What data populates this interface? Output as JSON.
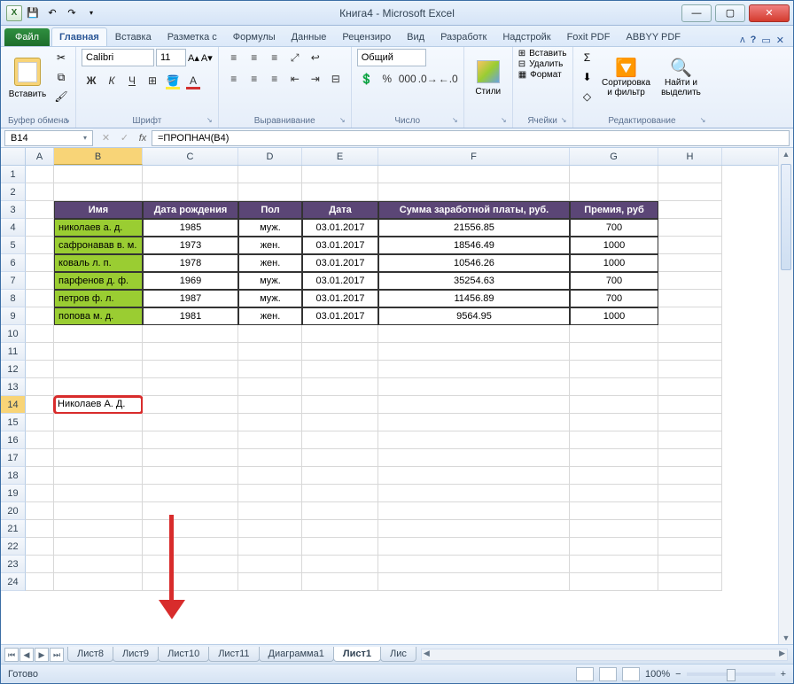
{
  "title": "Книга4 - Microsoft Excel",
  "tabs": {
    "file": "Файл",
    "home": "Главная",
    "insert": "Вставка",
    "layout": "Разметка с",
    "formulas": "Формулы",
    "data": "Данные",
    "review": "Рецензиро",
    "view": "Вид",
    "developer": "Разработк",
    "addins": "Надстройк",
    "foxit": "Foxit PDF",
    "abbyy": "ABBYY PDF"
  },
  "ribbon": {
    "paste": "Вставить",
    "clipboard": "Буфер обмена",
    "font_name": "Calibri",
    "font_size": "11",
    "font_group": "Шрифт",
    "align_group": "Выравнивание",
    "number_format": "Общий",
    "number_group": "Число",
    "styles": "Стили",
    "insert_cells": "Вставить",
    "delete_cells": "Удалить",
    "format_cells": "Формат",
    "cells_group": "Ячейки",
    "sort": "Сортировка\nи фильтр",
    "find": "Найти и\nвыделить",
    "editing_group": "Редактирование"
  },
  "name_box": "B14",
  "formula": "=ПРОПНАЧ(B4)",
  "col_headers": [
    "A",
    "B",
    "C",
    "D",
    "E",
    "F",
    "G",
    "H"
  ],
  "row_headers": [
    "1",
    "2",
    "3",
    "4",
    "5",
    "6",
    "7",
    "8",
    "9",
    "10",
    "11",
    "12",
    "13",
    "14",
    "15",
    "16",
    "17",
    "18",
    "19",
    "20",
    "21",
    "22",
    "23",
    "24"
  ],
  "table": {
    "headers": [
      "Имя",
      "Дата рождения",
      "Пол",
      "Дата",
      "Сумма заработной платы, руб.",
      "Премия, руб"
    ],
    "rows": [
      [
        "николаев а. д.",
        "1985",
        "муж.",
        "03.01.2017",
        "21556.85",
        "700"
      ],
      [
        "сафронавав в. м.",
        "1973",
        "жен.",
        "03.01.2017",
        "18546.49",
        "1000"
      ],
      [
        "коваль л. п.",
        "1978",
        "жен.",
        "03.01.2017",
        "10546.26",
        "1000"
      ],
      [
        "парфенов д. ф.",
        "1969",
        "муж.",
        "03.01.2017",
        "35254.63",
        "700"
      ],
      [
        "петров ф. л.",
        "1987",
        "муж.",
        "03.01.2017",
        "11456.89",
        "700"
      ],
      [
        "попова м. д.",
        "1981",
        "жен.",
        "03.01.2017",
        "9564.95",
        "1000"
      ]
    ]
  },
  "result_cell": "Николаев А. Д.",
  "sheet_tabs": [
    "Лист8",
    "Лист9",
    "Лист10",
    "Лист11",
    "Диаграмма1",
    "Лист1",
    "Лис"
  ],
  "active_sheet": "Лист1",
  "status": "Готово",
  "zoom": "100%"
}
